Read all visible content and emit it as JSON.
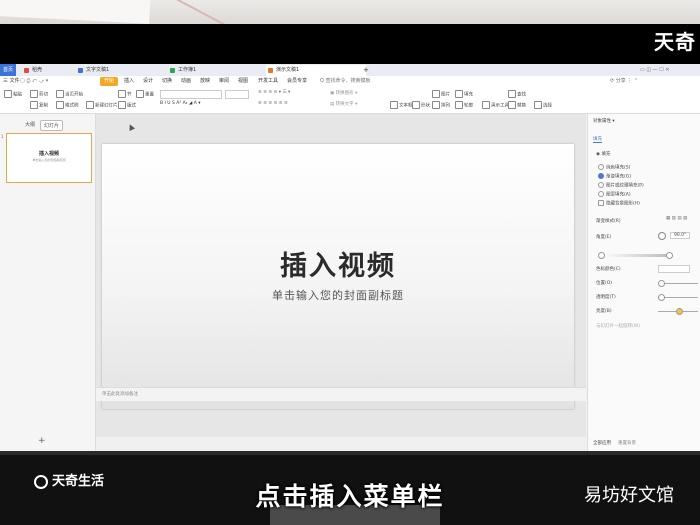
{
  "watermarks": {
    "top_right": "天奇",
    "bottom_left": "天奇生活",
    "bottom_right": "易坊好文馆"
  },
  "caption": "点击插入菜单栏",
  "tabs": [
    {
      "label": "首页",
      "color": "#3a73d9"
    },
    {
      "label": "稻壳",
      "color": "#e04b3a"
    },
    {
      "label": "文字文稿1",
      "color": "#3a73d9"
    },
    {
      "label": "工作簿1",
      "color": "#2fa35a"
    },
    {
      "label": "演示文稿1",
      "color": "#e8792b"
    }
  ],
  "menu": {
    "file": "三 文件",
    "start": "开始",
    "items": [
      "插入",
      "设计",
      "切换",
      "动画",
      "放映",
      "审阅",
      "视图",
      "开发工具",
      "会员专享"
    ],
    "search": "Q 查找命令、搜索模板"
  },
  "ribbon": {
    "row1": [
      "粘贴",
      "剪切",
      "复制",
      "格式刷",
      "当页开始",
      "新建幻灯片",
      "版式",
      "节",
      "重置",
      "文本框",
      "形状",
      "排列",
      "图片",
      "填充",
      "轮廓",
      "演示工具",
      "查找",
      "替换",
      "选择"
    ],
    "row2": []
  },
  "left_panel": {
    "tab_outline": "大纲",
    "tab_slides": "幻灯片",
    "slide_number": "1",
    "thumb_title": "插入视频",
    "thumb_sub": "单击输入您的封面副标题",
    "add": "+"
  },
  "slide": {
    "title": "插入视频",
    "subtitle": "单击输入您的封面副标题"
  },
  "notes": "单击此处添加备注",
  "right_panel": {
    "title": "对象属性 ▾",
    "section": "填充",
    "fill_header": "◉ 填充",
    "options": [
      "纯色填充(S)",
      "渐变填充(G)",
      "图片或纹理填充(P)",
      "图案填充(A)",
      "隐藏背景图形(H)"
    ],
    "selected_index": 1,
    "gradient_style": "渐变样式(R)",
    "angle_label": "角度(E)",
    "angle_value": "90.0°",
    "color_stop": "色标颜色(C)",
    "position": "位置(O)",
    "transparency": "透明度(T)",
    "brightness": "亮度(B)",
    "checkbox": "与幻灯片一起旋转(W)",
    "footer_apply": "全部应用",
    "footer_reset": "重置背景"
  }
}
